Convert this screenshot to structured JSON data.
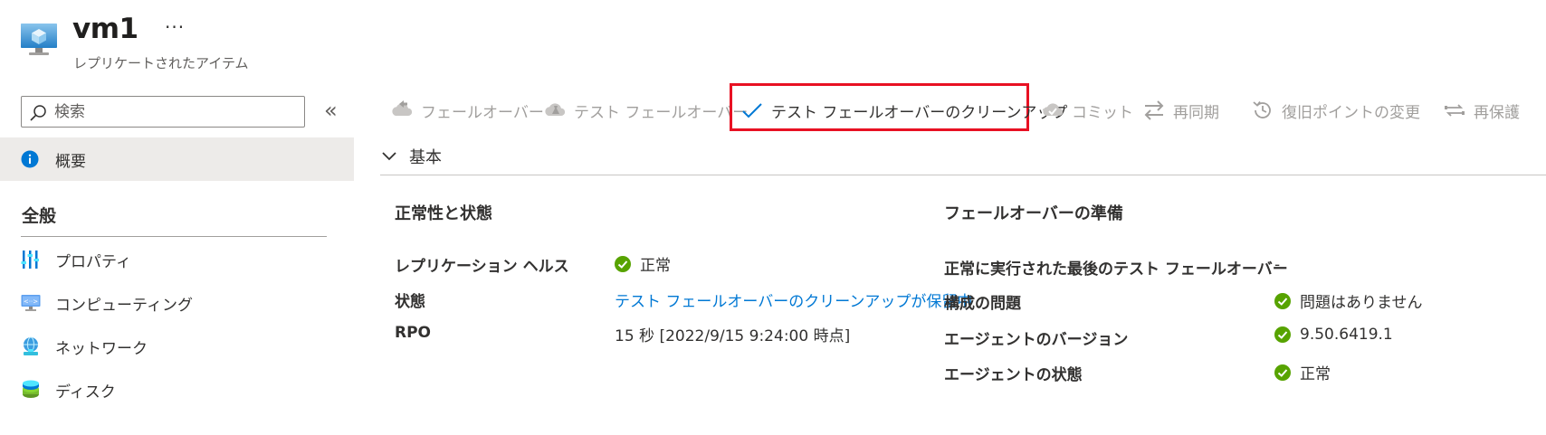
{
  "header": {
    "title": "vm1",
    "subtitle": "レプリケートされたアイテム",
    "more": "···"
  },
  "sidebar": {
    "search_placeholder": "検索",
    "collapse": "«",
    "overview": "概要",
    "section_general": "全般",
    "items": [
      {
        "label": "プロパティ",
        "icon": "properties-icon"
      },
      {
        "label": "コンピューティング",
        "icon": "compute-icon"
      },
      {
        "label": "ネットワーク",
        "icon": "network-icon"
      },
      {
        "label": "ディスク",
        "icon": "disk-icon"
      }
    ]
  },
  "toolbar": {
    "failover": "フェールオーバー",
    "test_failover": "テスト フェールオーバー",
    "cleanup": "テスト フェールオーバーのクリーンアップ",
    "commit": "コミット",
    "resync": "再同期",
    "change_recovery_point": "復旧ポイントの変更",
    "reprotect": "再保護"
  },
  "essentials": {
    "toggle_label": "基本",
    "health": {
      "heading": "正常性と状態",
      "replication_health_label": "レプリケーション ヘルス",
      "replication_health_value": "正常",
      "status_label": "状態",
      "status_value": "テスト フェールオーバーのクリーンアップが保留中",
      "rpo_label": "RPO",
      "rpo_value": "15 秒 [2022/9/15 9:24:00 時点]"
    },
    "failover_readiness": {
      "heading": "フェールオーバーの準備",
      "last_test_label": "正常に実行された最後のテスト フェールオーバー",
      "last_test_value": "-",
      "config_issues_label": "構成の問題",
      "config_issues_value": "問題はありません",
      "agent_version_label": "エージェントのバージョン",
      "agent_version_value": "9.50.6419.1",
      "agent_status_label": "エージェントの状態",
      "agent_status_value": "正常"
    }
  },
  "colors": {
    "accent": "#0078d4",
    "highlight_border": "#e81123",
    "success": "#57a300",
    "disabled_text": "#a19f9d"
  }
}
